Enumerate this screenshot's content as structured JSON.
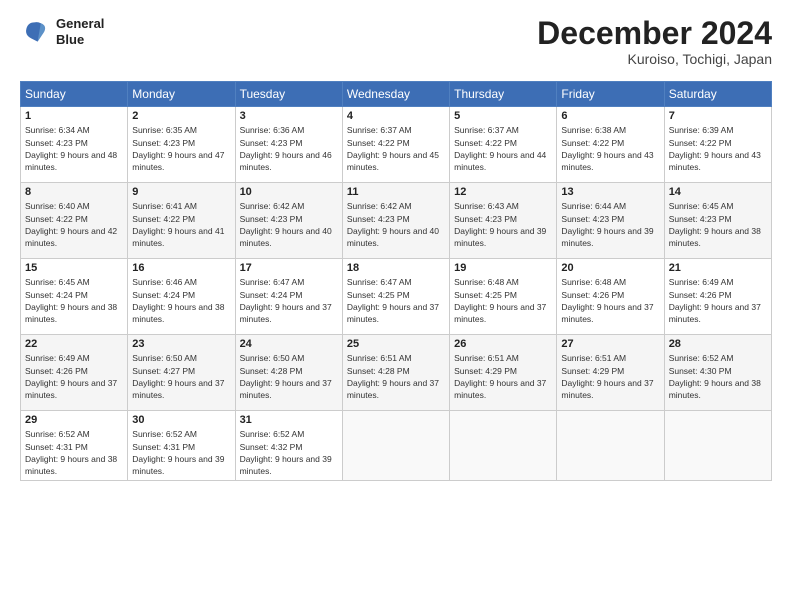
{
  "header": {
    "logo_line1": "General",
    "logo_line2": "Blue",
    "month": "December 2024",
    "location": "Kuroiso, Tochigi, Japan"
  },
  "weekdays": [
    "Sunday",
    "Monday",
    "Tuesday",
    "Wednesday",
    "Thursday",
    "Friday",
    "Saturday"
  ],
  "weeks": [
    [
      {
        "day": "1",
        "sunrise": "6:34 AM",
        "sunset": "4:23 PM",
        "daylight": "9 hours and 48 minutes."
      },
      {
        "day": "2",
        "sunrise": "6:35 AM",
        "sunset": "4:23 PM",
        "daylight": "9 hours and 47 minutes."
      },
      {
        "day": "3",
        "sunrise": "6:36 AM",
        "sunset": "4:23 PM",
        "daylight": "9 hours and 46 minutes."
      },
      {
        "day": "4",
        "sunrise": "6:37 AM",
        "sunset": "4:22 PM",
        "daylight": "9 hours and 45 minutes."
      },
      {
        "day": "5",
        "sunrise": "6:37 AM",
        "sunset": "4:22 PM",
        "daylight": "9 hours and 44 minutes."
      },
      {
        "day": "6",
        "sunrise": "6:38 AM",
        "sunset": "4:22 PM",
        "daylight": "9 hours and 43 minutes."
      },
      {
        "day": "7",
        "sunrise": "6:39 AM",
        "sunset": "4:22 PM",
        "daylight": "9 hours and 43 minutes."
      }
    ],
    [
      {
        "day": "8",
        "sunrise": "6:40 AM",
        "sunset": "4:22 PM",
        "daylight": "9 hours and 42 minutes."
      },
      {
        "day": "9",
        "sunrise": "6:41 AM",
        "sunset": "4:22 PM",
        "daylight": "9 hours and 41 minutes."
      },
      {
        "day": "10",
        "sunrise": "6:42 AM",
        "sunset": "4:23 PM",
        "daylight": "9 hours and 40 minutes."
      },
      {
        "day": "11",
        "sunrise": "6:42 AM",
        "sunset": "4:23 PM",
        "daylight": "9 hours and 40 minutes."
      },
      {
        "day": "12",
        "sunrise": "6:43 AM",
        "sunset": "4:23 PM",
        "daylight": "9 hours and 39 minutes."
      },
      {
        "day": "13",
        "sunrise": "6:44 AM",
        "sunset": "4:23 PM",
        "daylight": "9 hours and 39 minutes."
      },
      {
        "day": "14",
        "sunrise": "6:45 AM",
        "sunset": "4:23 PM",
        "daylight": "9 hours and 38 minutes."
      }
    ],
    [
      {
        "day": "15",
        "sunrise": "6:45 AM",
        "sunset": "4:24 PM",
        "daylight": "9 hours and 38 minutes."
      },
      {
        "day": "16",
        "sunrise": "6:46 AM",
        "sunset": "4:24 PM",
        "daylight": "9 hours and 38 minutes."
      },
      {
        "day": "17",
        "sunrise": "6:47 AM",
        "sunset": "4:24 PM",
        "daylight": "9 hours and 37 minutes."
      },
      {
        "day": "18",
        "sunrise": "6:47 AM",
        "sunset": "4:25 PM",
        "daylight": "9 hours and 37 minutes."
      },
      {
        "day": "19",
        "sunrise": "6:48 AM",
        "sunset": "4:25 PM",
        "daylight": "9 hours and 37 minutes."
      },
      {
        "day": "20",
        "sunrise": "6:48 AM",
        "sunset": "4:26 PM",
        "daylight": "9 hours and 37 minutes."
      },
      {
        "day": "21",
        "sunrise": "6:49 AM",
        "sunset": "4:26 PM",
        "daylight": "9 hours and 37 minutes."
      }
    ],
    [
      {
        "day": "22",
        "sunrise": "6:49 AM",
        "sunset": "4:26 PM",
        "daylight": "9 hours and 37 minutes."
      },
      {
        "day": "23",
        "sunrise": "6:50 AM",
        "sunset": "4:27 PM",
        "daylight": "9 hours and 37 minutes."
      },
      {
        "day": "24",
        "sunrise": "6:50 AM",
        "sunset": "4:28 PM",
        "daylight": "9 hours and 37 minutes."
      },
      {
        "day": "25",
        "sunrise": "6:51 AM",
        "sunset": "4:28 PM",
        "daylight": "9 hours and 37 minutes."
      },
      {
        "day": "26",
        "sunrise": "6:51 AM",
        "sunset": "4:29 PM",
        "daylight": "9 hours and 37 minutes."
      },
      {
        "day": "27",
        "sunrise": "6:51 AM",
        "sunset": "4:29 PM",
        "daylight": "9 hours and 37 minutes."
      },
      {
        "day": "28",
        "sunrise": "6:52 AM",
        "sunset": "4:30 PM",
        "daylight": "9 hours and 38 minutes."
      }
    ],
    [
      {
        "day": "29",
        "sunrise": "6:52 AM",
        "sunset": "4:31 PM",
        "daylight": "9 hours and 38 minutes."
      },
      {
        "day": "30",
        "sunrise": "6:52 AM",
        "sunset": "4:31 PM",
        "daylight": "9 hours and 39 minutes."
      },
      {
        "day": "31",
        "sunrise": "6:52 AM",
        "sunset": "4:32 PM",
        "daylight": "9 hours and 39 minutes."
      },
      null,
      null,
      null,
      null
    ]
  ]
}
